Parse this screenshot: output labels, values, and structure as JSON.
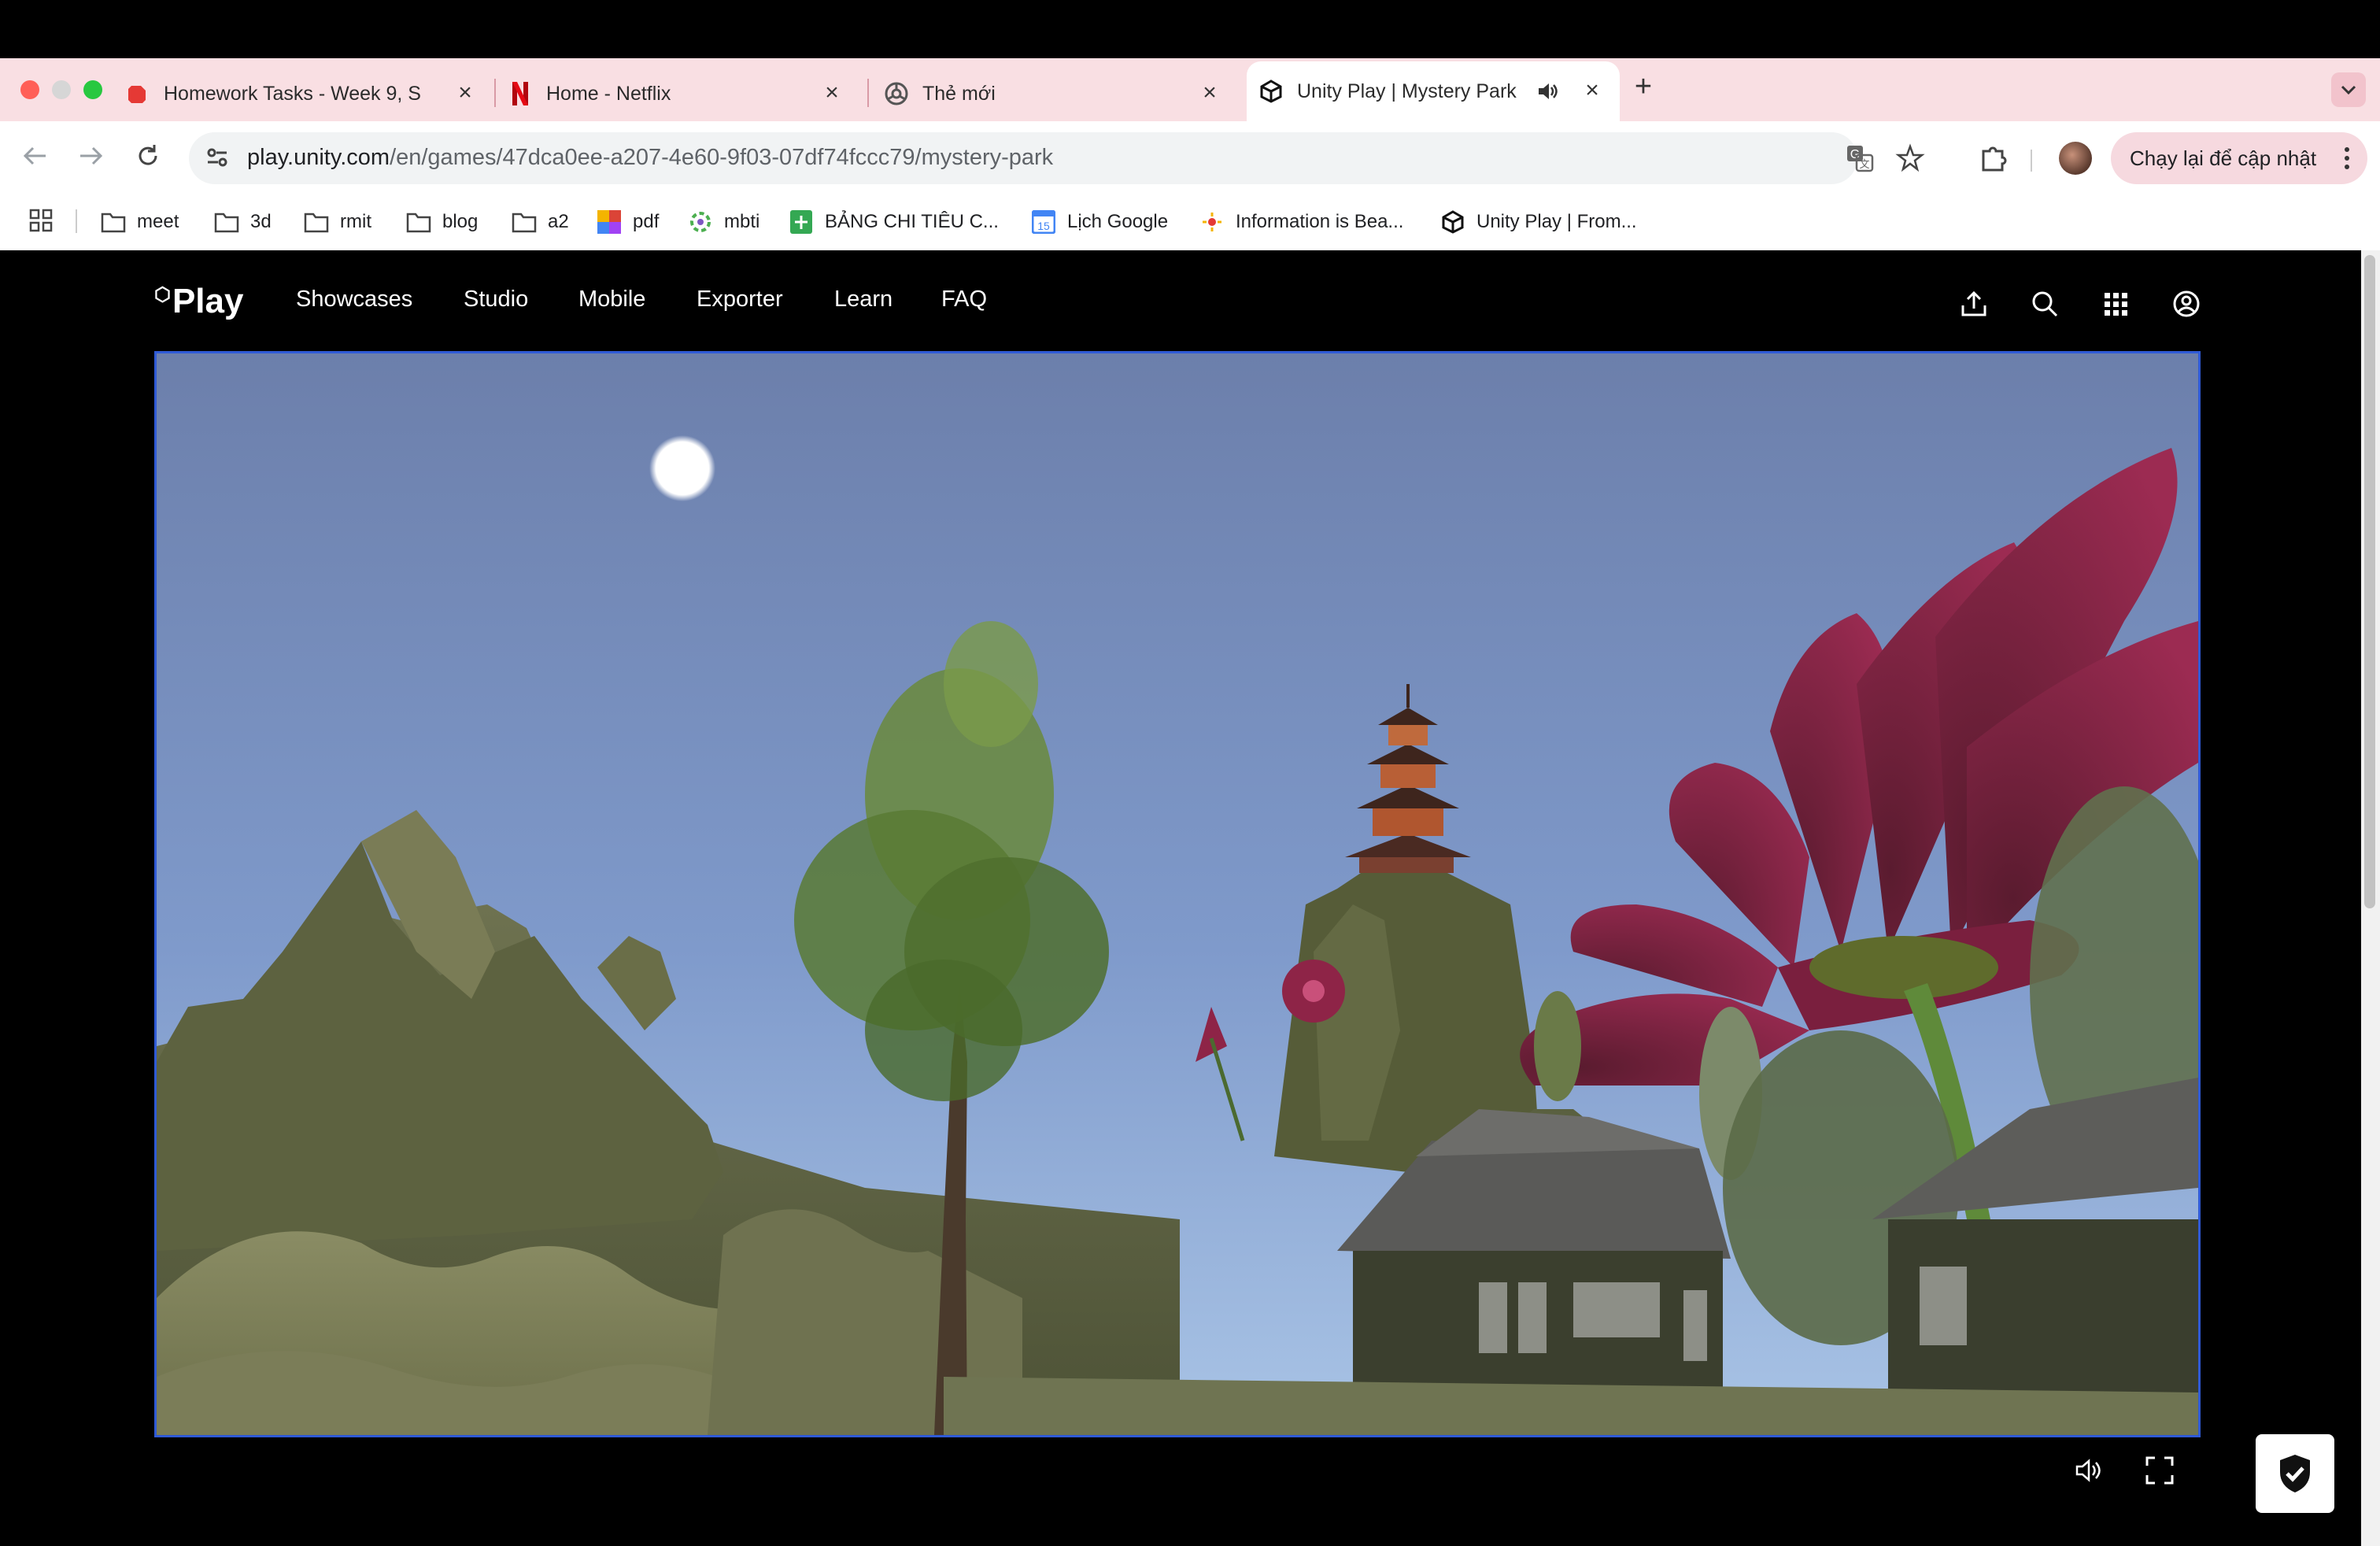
{
  "browser": {
    "tabs": [
      {
        "title": "Homework Tasks - Week 9, S",
        "icon": "red-app-icon"
      },
      {
        "title": "Home - Netflix",
        "icon": "netflix-icon"
      },
      {
        "title": "Thẻ mới",
        "icon": "chrome-icon"
      },
      {
        "title": "Unity Play | Mystery Park",
        "icon": "unity-icon",
        "active": true,
        "audio": true
      }
    ],
    "url_host": "play.unity.com",
    "url_path": "/en/games/47dca0ee-a207-4e60-9f03-07df74fccc79/mystery-park",
    "update_button": "Chạy lại để cập nhật",
    "bookmarks": [
      {
        "label": "meet",
        "icon": "folder-icon"
      },
      {
        "label": "3d",
        "icon": "folder-icon"
      },
      {
        "label": "rmit",
        "icon": "folder-icon"
      },
      {
        "label": "blog",
        "icon": "folder-icon"
      },
      {
        "label": "a2",
        "icon": "folder-icon"
      },
      {
        "label": "pdf",
        "icon": "pdf-colorful-icon"
      },
      {
        "label": "mbti",
        "icon": "mbti-icon"
      },
      {
        "label": "BẢNG CHI TIÊU C...",
        "icon": "sheets-icon"
      },
      {
        "label": "Lịch Google",
        "icon": "calendar-icon"
      },
      {
        "label": "Information is Bea...",
        "icon": "info-beautiful-icon"
      },
      {
        "label": "Unity Play | From...",
        "icon": "unity-icon"
      }
    ]
  },
  "site": {
    "logo": "Play",
    "nav": [
      "Showcases",
      "Studio",
      "Mobile",
      "Exporter",
      "Learn",
      "FAQ"
    ]
  },
  "colors": {
    "tabstrip": "#f9dfe3",
    "game_border": "#2f5ad6",
    "sky_top": "#6c7fab",
    "flower": "#8e2447"
  }
}
